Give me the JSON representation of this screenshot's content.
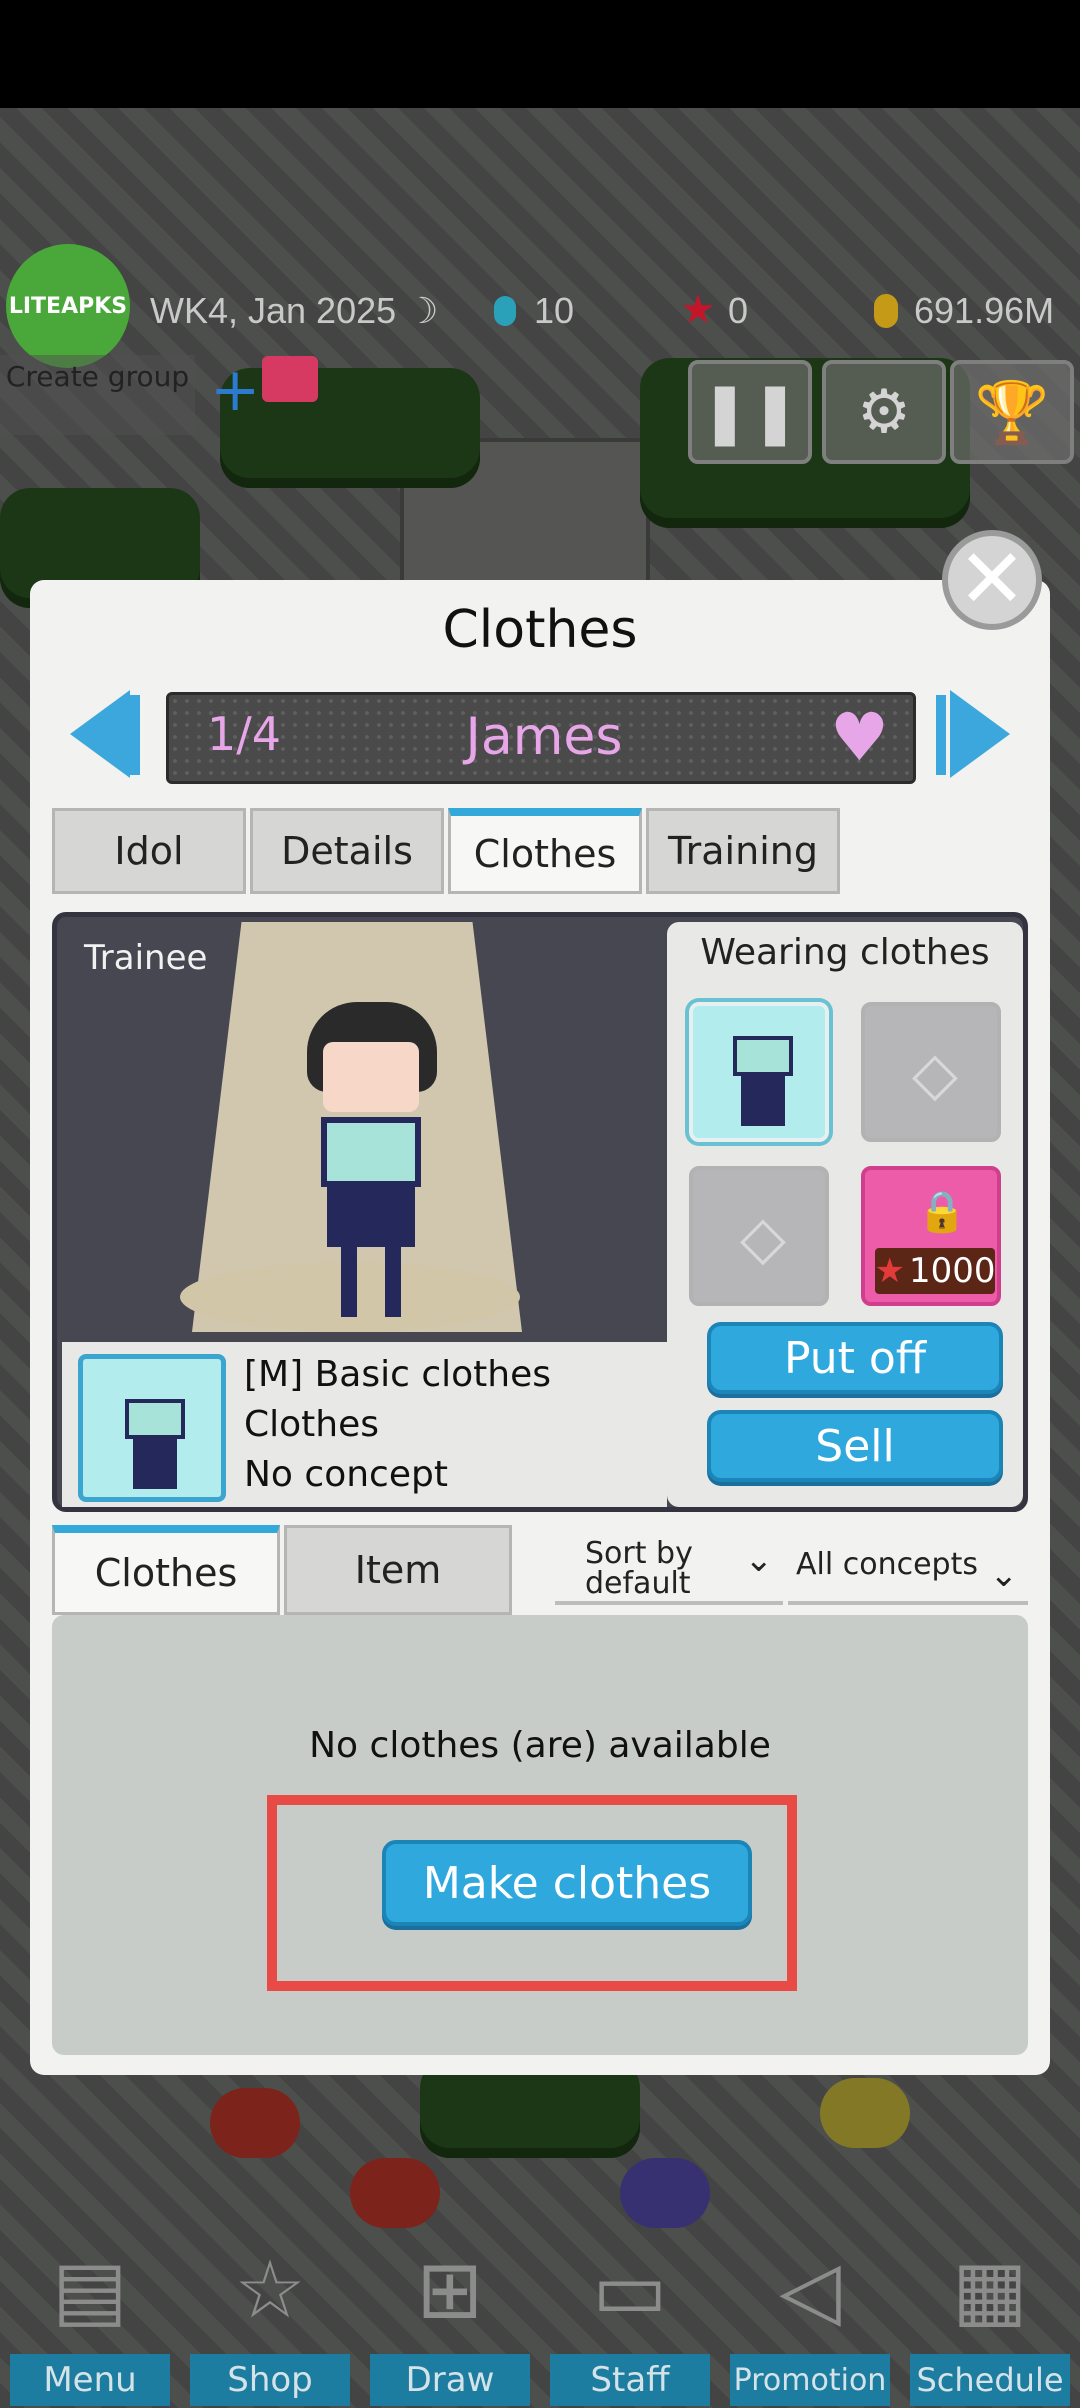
{
  "hud": {
    "logo": "LITEAPKS",
    "date": "WK4, Jan 2025",
    "moon": "☽",
    "gems": "10",
    "stars": "0",
    "money": "691.96M",
    "create_group": "Create group",
    "plus": "+"
  },
  "modal": {
    "title": "Clothes",
    "index": "1/4",
    "name": "James",
    "tabs": [
      "Idol",
      "Details",
      "Clothes",
      "Training"
    ],
    "active_tab": "Clothes"
  },
  "character": {
    "rank": "Trainee",
    "wearing_title": "Wearing clothes",
    "lock_price": "1000",
    "item_name": "[M] Basic clothes",
    "item_type": "Clothes",
    "item_concept": "No concept",
    "put_off": "Put off",
    "sell": "Sell"
  },
  "inventory": {
    "tabs": [
      "Clothes",
      "Item"
    ],
    "sort_label": "Sort by default",
    "concept_filter": "All concepts",
    "empty_text": "No clothes (are) available",
    "make_button": "Make clothes"
  },
  "nav": [
    {
      "label": "Menu",
      "icon": "menu-icon"
    },
    {
      "label": "Shop",
      "icon": "star-icon"
    },
    {
      "label": "Draw",
      "icon": "gift-icon"
    },
    {
      "label": "Staff",
      "icon": "id-card-icon"
    },
    {
      "label": "Promotion",
      "icon": "megaphone-icon"
    },
    {
      "label": "Schedule",
      "icon": "calendar-icon"
    }
  ],
  "colors": {
    "accent": "#2fa8de",
    "name_text": "#e7a6e8",
    "locked_slot": "#ec5ca9",
    "highlight_box": "#e84a45"
  }
}
